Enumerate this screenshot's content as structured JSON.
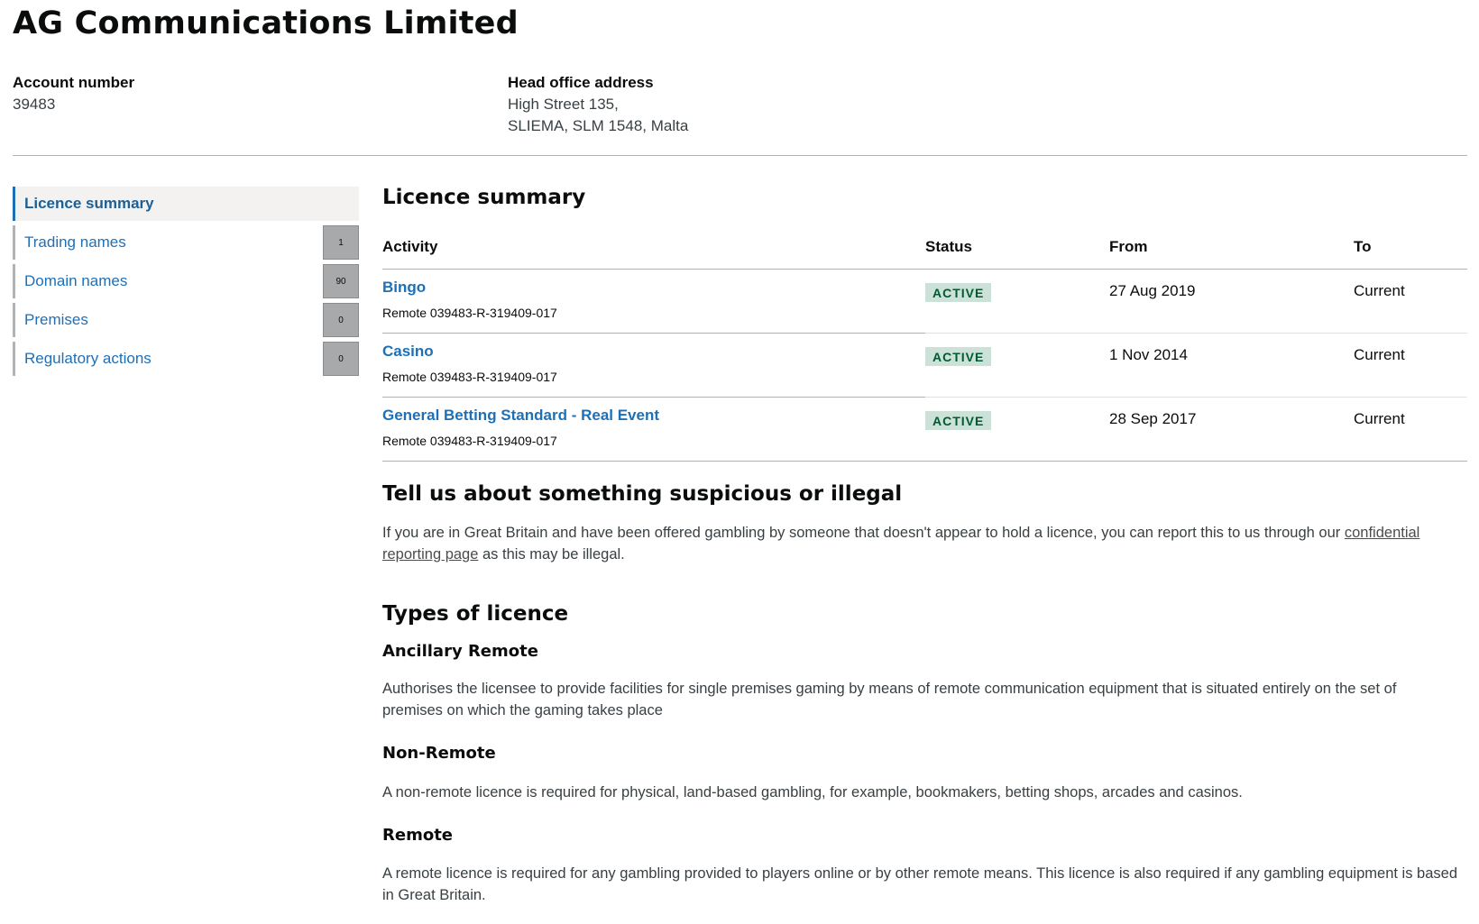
{
  "company": {
    "name": "AG Communications Limited",
    "account_label": "Account number",
    "account_value": "39483",
    "address_label": "Head office address",
    "address_line1": "High Street 135,",
    "address_line2": "SLIEMA, SLM 1548, Malta"
  },
  "sidebar": {
    "items": [
      {
        "label": "Licence summary",
        "count": null
      },
      {
        "label": "Trading names",
        "count": "1"
      },
      {
        "label": "Domain names",
        "count": "90"
      },
      {
        "label": "Premises",
        "count": "0"
      },
      {
        "label": "Regulatory actions",
        "count": "0"
      }
    ]
  },
  "licence_summary": {
    "heading": "Licence summary",
    "columns": {
      "activity": "Activity",
      "status": "Status",
      "from": "From",
      "to": "To"
    },
    "rows": [
      {
        "activity": "Bingo",
        "ref": "Remote 039483-R-319409-017",
        "status": "ACTIVE",
        "from": "27 Aug 2019",
        "to": "Current"
      },
      {
        "activity": "Casino",
        "ref": "Remote 039483-R-319409-017",
        "status": "ACTIVE",
        "from": "1 Nov 2014",
        "to": "Current"
      },
      {
        "activity": "General Betting Standard - Real Event",
        "ref": "Remote 039483-R-319409-017",
        "status": "ACTIVE",
        "from": "28 Sep 2017",
        "to": "Current"
      }
    ]
  },
  "suspicious": {
    "heading": "Tell us about something suspicious or illegal",
    "text_before": "If you are in Great Britain and have been offered gambling by someone that doesn't appear to hold a licence, you can report this to us through our ",
    "link_text": "confidential reporting page",
    "text_after": " as this may be illegal."
  },
  "types": {
    "heading": "Types of licence",
    "items": [
      {
        "title": "Ancillary Remote",
        "text": "Authorises the licensee to provide facilities for single premises gaming by means of remote communication equipment that is situated entirely on the set of premises on which the gaming takes place"
      },
      {
        "title": "Non-Remote",
        "text": "A non-remote licence is required for physical, land-based gambling, for example, bookmakers, betting shops, arcades and casinos."
      },
      {
        "title": "Remote",
        "text": "A remote licence is required for any gambling provided to players online or by other remote means. This licence is also required if any gambling equipment is based in Great Britain."
      }
    ]
  },
  "colors": {
    "link": "#1d70b8",
    "tag_bg": "#cce2d8",
    "tag_text": "#005a30",
    "count_bg": "#a8a9aa"
  }
}
